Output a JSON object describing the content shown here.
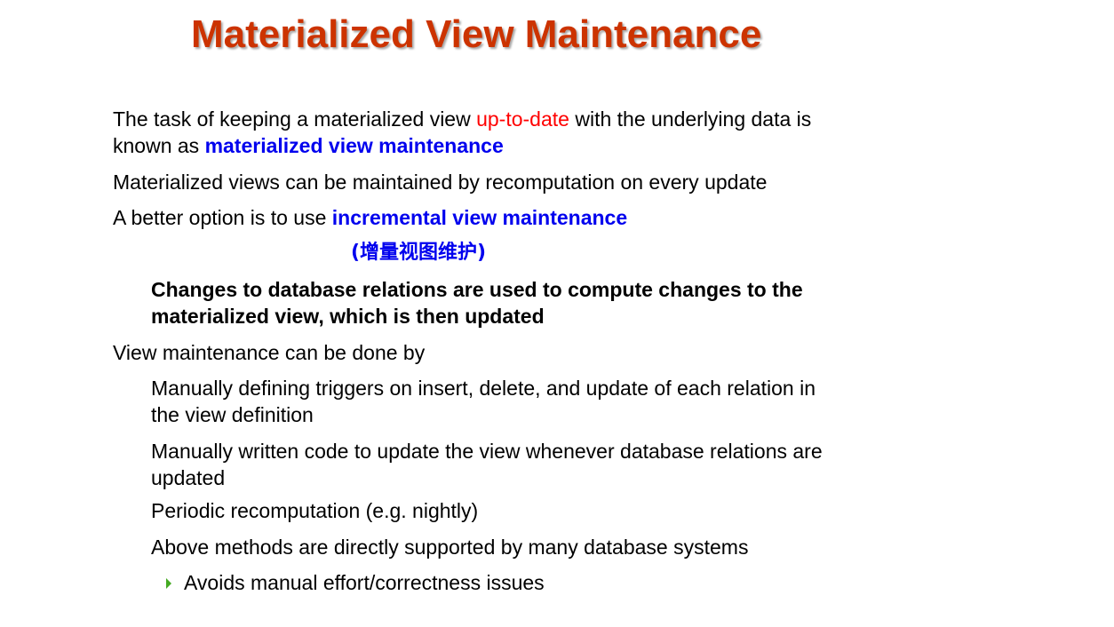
{
  "slide": {
    "title": "Materialized View Maintenance",
    "p1": {
      "line1_a": "The task of keeping a materialized view ",
      "line1_b": "up-to-date",
      "line1_c": " with the underlying data is",
      "line2_a": "known as ",
      "line2_b": "materialized view maintenance"
    },
    "p2": "Materialized views can be maintained by recomputation on every update",
    "p3": {
      "a": "A better option is to use ",
      "b": "incremental view maintenance"
    },
    "p3_cn": "(增量视图维护)",
    "p4": {
      "line1": "Changes to database relations are used to compute changes to the",
      "line2": "materialized view, which is then updated"
    },
    "p5": "View maintenance can be done by",
    "p6": {
      "line1": "Manually defining triggers on insert, delete, and update of each relation in",
      "line2": "the view definition"
    },
    "p7": {
      "line1": "Manually written code to update the view whenever database relations are",
      "line2": "updated"
    },
    "p8": "Periodic recomputation (e.g. nightly)",
    "p9": "Above methods are directly supported by many database systems",
    "p10": "Avoids manual effort/correctness issues"
  },
  "colors": {
    "title": "#cc3300",
    "highlight_red": "#ff0000",
    "highlight_blue": "#0000ee",
    "bullet_arrow": "#44aa22"
  },
  "icons": {
    "sub_bullet": "right-triangle-icon"
  }
}
